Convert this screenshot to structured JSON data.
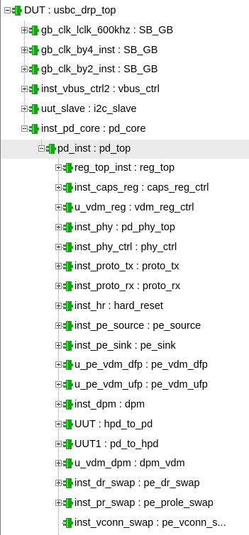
{
  "tree": {
    "root": {
      "label": "DUT : usbc_drp_top",
      "expanded": true
    },
    "level1": [
      {
        "label": "gb_clk_lclk_600khz : SB_GB",
        "expanded": false
      },
      {
        "label": "gb_clk_by4_inst : SB_GB",
        "expanded": false
      },
      {
        "label": "gb_clk_by2_inst : SB_GB",
        "expanded": false
      },
      {
        "label": "inst_vbus_ctrl2 : vbus_ctrl",
        "expanded": false
      },
      {
        "label": "uut_slave : i2c_slave",
        "expanded": false
      },
      {
        "label": "inst_pd_core : pd_core",
        "expanded": true
      }
    ],
    "level2": [
      {
        "label": "pd_inst : pd_top",
        "expanded": true,
        "selected": true
      }
    ],
    "level3": [
      {
        "label": "reg_top_inst : reg_top",
        "expanded": false
      },
      {
        "label": "inst_caps_reg : caps_reg_ctrl",
        "expanded": false
      },
      {
        "label": "u_vdm_reg : vdm_reg_ctrl",
        "expanded": false
      },
      {
        "label": "inst_phy : pd_phy_top",
        "expanded": false
      },
      {
        "label": "inst_phy_ctrl : phy_ctrl",
        "expanded": false
      },
      {
        "label": "inst_proto_tx : proto_tx",
        "expanded": false
      },
      {
        "label": "inst_proto_rx : proto_rx",
        "expanded": false
      },
      {
        "label": "inst_hr : hard_reset",
        "expanded": false
      },
      {
        "label": "inst_pe_source : pe_source",
        "expanded": false
      },
      {
        "label": "inst_pe_sink : pe_sink",
        "expanded": false
      },
      {
        "label": "u_pe_vdm_dfp : pe_vdm_dfp",
        "expanded": false
      },
      {
        "label": "u_pe_vdm_ufp : pe_vdm_ufp",
        "expanded": false
      },
      {
        "label": "inst_dpm : dpm",
        "expanded": false
      },
      {
        "label": "UUT : hpd_to_pd",
        "expanded": false
      },
      {
        "label": "UUT1 : pd_to_hpd",
        "expanded": false
      },
      {
        "label": "u_vdm_dpm : dpm_vdm",
        "expanded": false
      },
      {
        "label": "inst_dr_swap : pe_dr_swap",
        "expanded": false
      },
      {
        "label": "inst_pr_swap : pe_prole_swap",
        "expanded": false
      },
      {
        "label": "inst_vconn_swap : pe_vconn_s..."
      }
    ],
    "icon": "module-icon",
    "colors": {
      "icon_green": "#1aa01a",
      "selection": "#ebebeb"
    }
  }
}
